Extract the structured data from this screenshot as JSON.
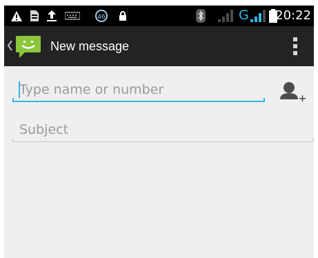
{
  "status_bar": {
    "time": "20:22",
    "network_type": "G",
    "badge_value": "46",
    "icons": [
      "warning-icon",
      "sim-card-icon",
      "upload-icon",
      "keyboard-icon",
      "notification-badge",
      "lock-icon",
      "bluetooth-icon",
      "signal-icon",
      "signal-icon",
      "battery-icon"
    ]
  },
  "action_bar": {
    "title": "New message",
    "app_icon": "messaging-app-icon",
    "menu_icon": "overflow-menu-icon"
  },
  "compose": {
    "recipient_placeholder": "Type name or number",
    "recipient_value": "",
    "subject_placeholder": "Subject",
    "subject_value": "",
    "add_contact_icon": "add-contact-icon"
  },
  "colors": {
    "accent": "#33b5e5",
    "action_bar": "#232323",
    "app_icon_green": "#8cc63e",
    "background": "#efefef"
  }
}
